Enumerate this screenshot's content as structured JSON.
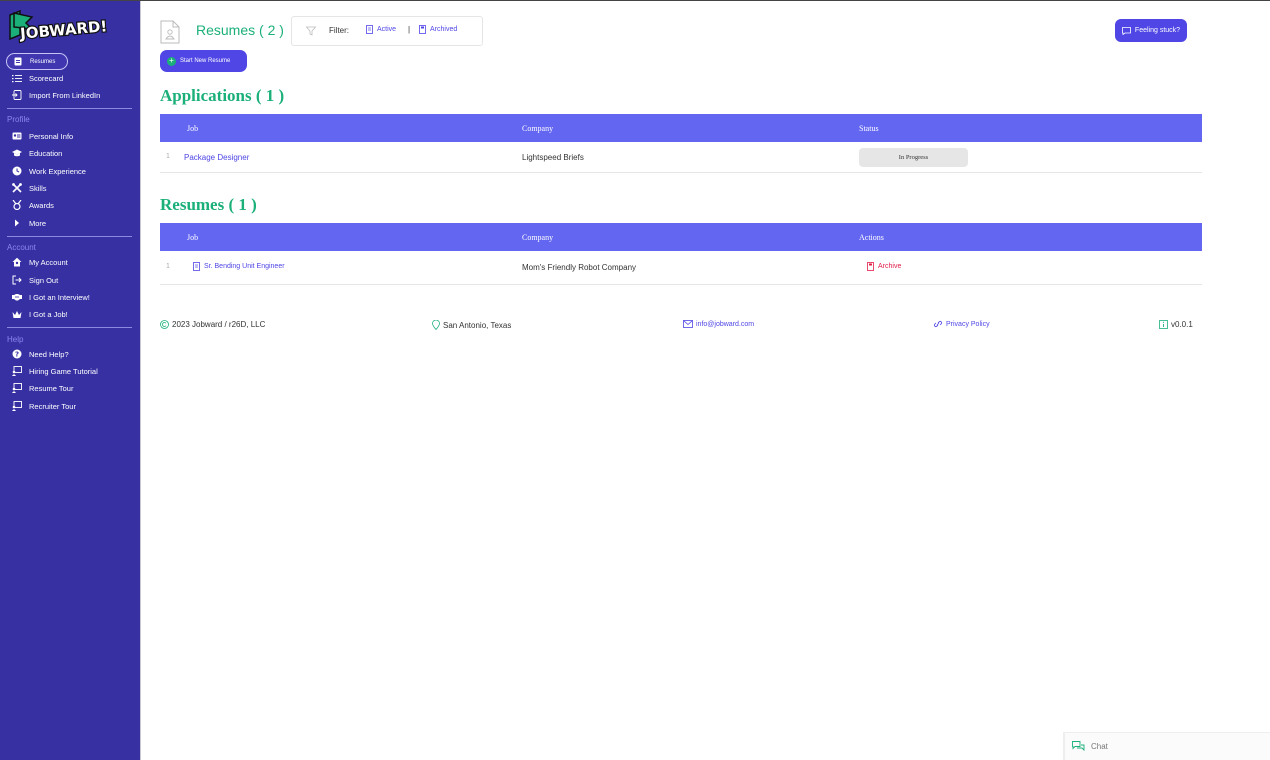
{
  "brand": {
    "logo_text": "JOBWARD!"
  },
  "sidebar": {
    "top_items": [
      {
        "label": "Resumes",
        "icon": "resume-icon",
        "active": true
      },
      {
        "label": "Scorecard",
        "icon": "list-icon"
      },
      {
        "label": "Import From LinkedIn",
        "icon": "import-icon"
      }
    ],
    "profile_label": "Profile",
    "profile_items": [
      {
        "label": "Personal Info",
        "icon": "id-card-icon"
      },
      {
        "label": "Education",
        "icon": "graduation-cap-icon"
      },
      {
        "label": "Work Experience",
        "icon": "clock-icon"
      },
      {
        "label": "Skills",
        "icon": "tools-icon"
      },
      {
        "label": "Awards",
        "icon": "medal-icon"
      },
      {
        "label": "More",
        "icon": "caret-right-icon"
      }
    ],
    "account_label": "Account",
    "account_items": [
      {
        "label": "My Account",
        "icon": "home-icon"
      },
      {
        "label": "Sign Out",
        "icon": "sign-out-icon"
      },
      {
        "label": "I Got an Interview!",
        "icon": "handshake-icon"
      },
      {
        "label": "I Got a Job!",
        "icon": "crown-icon"
      }
    ],
    "help_label": "Help",
    "help_items": [
      {
        "label": "Need Help?",
        "icon": "question-icon"
      },
      {
        "label": "Hiring Game Tutorial",
        "icon": "tutorial-icon"
      },
      {
        "label": "Resume Tour",
        "icon": "tour-icon"
      },
      {
        "label": "Recruiter Tour",
        "icon": "tour-icon"
      }
    ]
  },
  "header": {
    "title": "Resumes ( 2 )",
    "filter_label": "Filter:",
    "filter_active": "Active",
    "filter_separator": "|",
    "filter_archived": "Archived",
    "stuck_button": "Feeling stuck?",
    "new_resume_button": "Start New Resume"
  },
  "applications": {
    "title": "Applications ( 1 )",
    "columns": [
      "Job",
      "Company",
      "Status"
    ],
    "rows": [
      {
        "index": "1",
        "job": "Package Designer",
        "company": "Lightspeed Briefs",
        "status": "In Progress"
      }
    ]
  },
  "resumes": {
    "title": "Resumes ( 1 )",
    "columns": [
      "Job",
      "Company",
      "Actions"
    ],
    "rows": [
      {
        "index": "1",
        "job": "Sr. Bending Unit Engineer",
        "company": "Mom's Friendly Robot Company",
        "action": "Archive"
      }
    ]
  },
  "footer": {
    "copyright": "2023 Jobward / r26D, LLC",
    "location": "San Antonio, Texas",
    "email": "info@jobward.com",
    "privacy": "Privacy Policy",
    "version": "v0.0.1"
  },
  "chat": {
    "label": "Chat"
  },
  "colors": {
    "sidebar": "#3730a3",
    "accent": "#4f46e5",
    "table_header": "#6366f1",
    "title_green": "#1bb07a",
    "archive_red": "#e11d48"
  }
}
